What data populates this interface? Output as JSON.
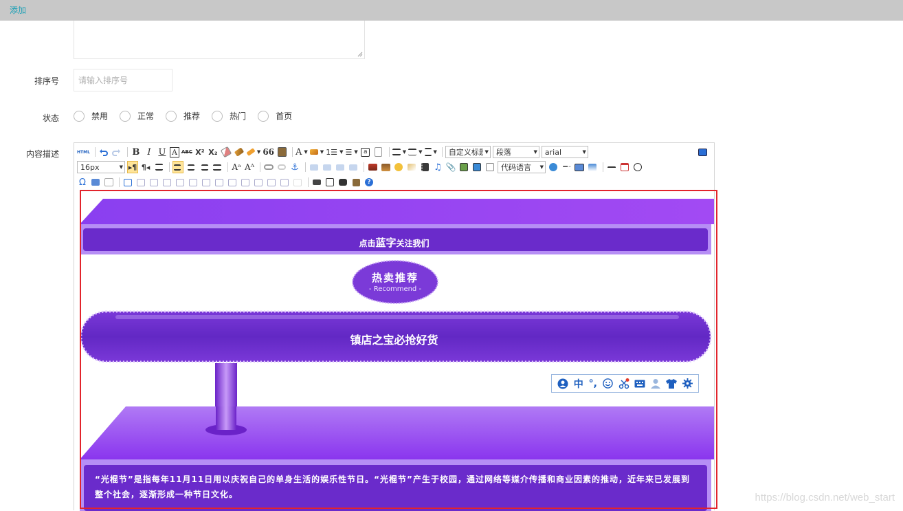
{
  "topbar": {
    "tab_label": "添加"
  },
  "form": {
    "sort_label": "排序号",
    "sort_placeholder": "请输入排序号",
    "status_label": "状态",
    "status_options": [
      "禁用",
      "正常",
      "推荐",
      "热门",
      "首页"
    ],
    "content_label": "内容描述"
  },
  "toolbar": {
    "row1": {
      "html_btn": "HTML",
      "bold": "B",
      "italic": "I",
      "underline": "U",
      "box": "A",
      "strike": "ABC",
      "sup": "X²",
      "sub": "X₂",
      "quote": "66",
      "fontcolor": "A",
      "list_ol": "1☰",
      "list_ul": "☰",
      "custom_heading": "自定义标题",
      "paragraph": "段落",
      "font": "arial"
    },
    "row2": {
      "fontsize": "16px",
      "code_lang": "代码语言"
    }
  },
  "banner": {
    "follow_prefix": "点击",
    "follow_emph": "蓝字",
    "follow_suffix": "关注我们",
    "hot_title": "热卖推荐",
    "hot_sub": "- Recommend -",
    "shelf_title": "镇店之宝必抢好货",
    "paragraph": "“光棍节”是指每年11月11日用以庆祝自己的单身生活的娱乐性节日。“光棍节”产生于校园，通过网络等媒介传播和商业因素的推动，近年来已发展到整个社会，逐渐形成一种节日文化。"
  },
  "ime": {
    "lang": "中",
    "punct": "°,",
    "icons": [
      "ime-logo-icon",
      "punct-icon",
      "emoji-icon",
      "scissors-icon",
      "keyboard-icon",
      "user-icon",
      "skin-icon",
      "settings-icon"
    ]
  },
  "watermark": "https://blog.csdn.net/web_start",
  "colors": {
    "accent": "#1a9fb5",
    "purple": "#7a2fe0",
    "purple_dark": "#6028c7",
    "red_box": "#e2242c"
  }
}
